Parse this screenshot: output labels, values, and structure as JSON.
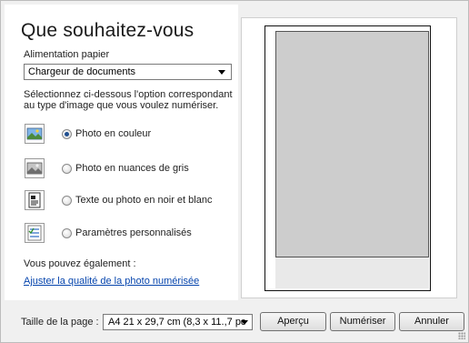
{
  "header": {
    "title": "Que souhaitez-vous"
  },
  "paper_feed": {
    "label": "Alimentation papier",
    "selected": "Chargeur de documents"
  },
  "description": "Sélectionnez ci-dessous l'option correspondant au type d'image que vous voulez numériser.",
  "options": [
    {
      "label": "Photo en couleur",
      "icon": "color-photo-icon",
      "checked": true
    },
    {
      "label": "Photo en nuances de gris",
      "icon": "grayscale-photo-icon",
      "checked": false
    },
    {
      "label": "Texte ou photo en noir et blanc",
      "icon": "black-white-document-icon",
      "checked": false
    },
    {
      "label": "Paramètres personnalisés",
      "icon": "custom-settings-icon",
      "checked": false
    }
  ],
  "extra": {
    "label": "Vous pouvez également :",
    "link": "Ajuster la qualité de la photo numérisée"
  },
  "footer": {
    "page_size_label": "Taille de la page :",
    "page_size_value": "A4 21 x 29,7 cm (8,3 x 11.,7 pc",
    "preview_button": "Aperçu",
    "scan_button": "Numériser",
    "cancel_button": "Annuler"
  }
}
